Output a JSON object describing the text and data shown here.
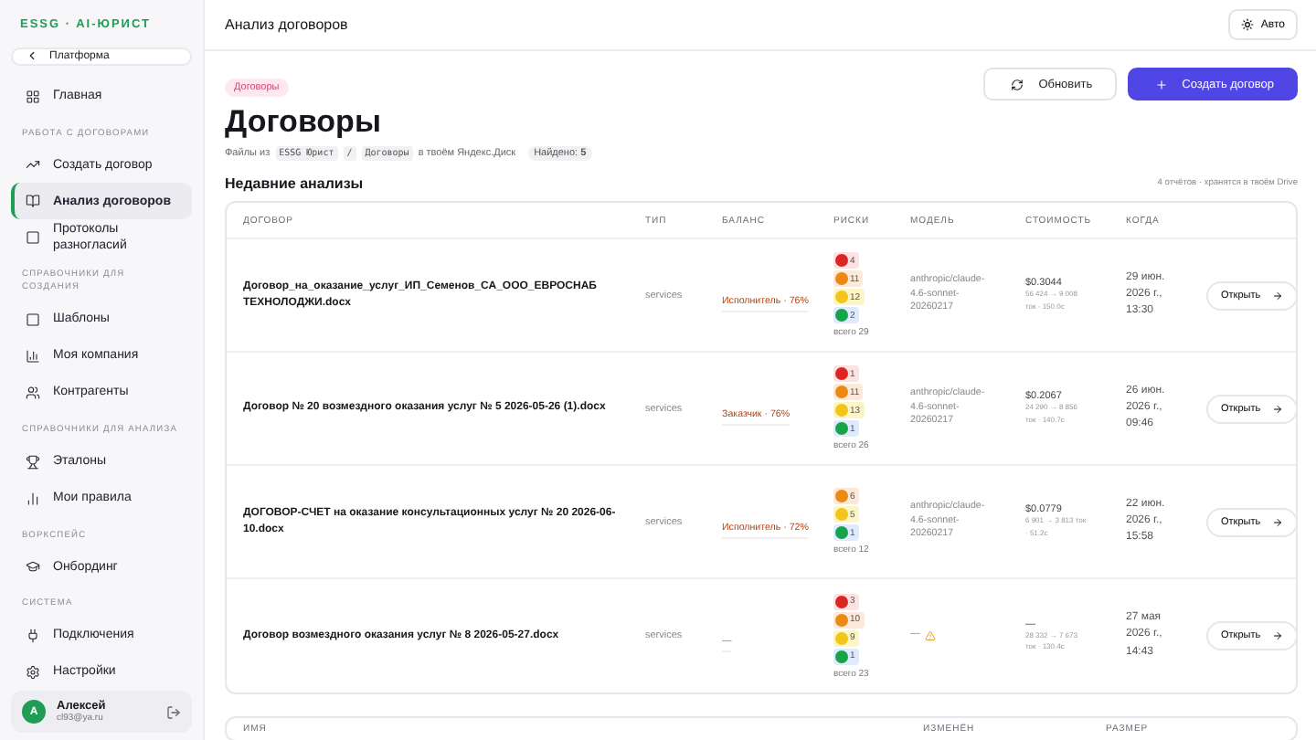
{
  "sidebar": {
    "logo": "ESSG · AI-ЮРИСТ",
    "back_button": "Платформа",
    "sections": [
      {
        "items": [
          {
            "label": "Главная",
            "selected": false
          }
        ]
      },
      {
        "title": "РАБОТА С ДОГОВОРАМИ",
        "items": [
          {
            "label": "Создать договор",
            "selected": false
          },
          {
            "label": "Анализ договоров",
            "selected": true
          },
          {
            "label": "Протоколы разногласий",
            "selected": false
          }
        ]
      },
      {
        "title": "СПРАВОЧНИКИ ДЛЯ СОЗДАНИЯ",
        "items": [
          {
            "label": "Шаблоны",
            "selected": false
          },
          {
            "label": "Моя компания",
            "selected": false
          },
          {
            "label": "Контрагенты",
            "selected": false
          }
        ]
      },
      {
        "title": "СПРАВОЧНИКИ ДЛЯ АНАЛИЗА",
        "items": [
          {
            "label": "Эталоны",
            "selected": false
          },
          {
            "label": "Мои правила",
            "selected": false
          }
        ]
      },
      {
        "title": "ВОРКСПЕЙС",
        "items": [
          {
            "label": "Онбординг",
            "selected": false
          }
        ]
      },
      {
        "title": "СИСТЕМА",
        "items": [
          {
            "label": "Подключения",
            "selected": false
          },
          {
            "label": "Настройки",
            "selected": false
          }
        ]
      }
    ],
    "user": {
      "initial": "А",
      "name": "Алексей",
      "email": "cl93@ya.ru"
    }
  },
  "topbar": {
    "title": "Анализ договоров",
    "theme_button": "Авто"
  },
  "page": {
    "badge": "Договоры",
    "title": "Договоры",
    "refresh_button": "Обновить",
    "create_button": "Создать договор",
    "path_prefix": "Файлы из",
    "path_segments": [
      "ESSG Юрист",
      "/",
      "Договоры"
    ],
    "path_suffix": "в твоём Яндекс.Диск",
    "found_label": "Найдено:",
    "found_count": "5"
  },
  "recent": {
    "title": "Недавние анализы",
    "note": "4 отчётов · хранятся в твоём Drive",
    "columns": [
      "ДОГОВОР",
      "ТИП",
      "БАЛАНС",
      "РИСКИ",
      "МОДЕЛЬ",
      "СТОИМОСТЬ",
      "КОГДА"
    ],
    "rows": [
      {
        "name": "Договор_на_оказание_услуг_ИП_Семенов_СА_ООО_ЕВРОСНАБ ТЕХНОЛОДЖИ.docx",
        "type": "services",
        "balance": "Исполнитель · 76%",
        "risks": [
          {
            "color": "#dc2626",
            "count": "4"
          },
          {
            "color": "#ea8a12",
            "count": "11"
          },
          {
            "color": "#f2c51b",
            "count": "12"
          },
          {
            "color": "#16a34a",
            "count": "2"
          }
        ],
        "risk_total": "всего 29",
        "model": "anthropic/claude-4.6-sonnet-20260217",
        "model_warning": false,
        "cost": "$0.3044",
        "tokens": "56 424 → 9 008",
        "tokens_detail": "ток · 150.0с",
        "when": "29 июн. 2026 г., 13:30",
        "open_button": "Открыть"
      },
      {
        "name": "Договор № 20 возмездного оказания услуг № 5 2026-05-26 (1).docx",
        "type": "services",
        "balance": "Заказчик · 76%",
        "risks": [
          {
            "color": "#dc2626",
            "count": "1"
          },
          {
            "color": "#ea8a12",
            "count": "11"
          },
          {
            "color": "#f2c51b",
            "count": "13"
          },
          {
            "color": "#16a34a",
            "count": "1"
          }
        ],
        "risk_total": "всего 26",
        "model": "anthropic/claude-4.6-sonnet-20260217",
        "model_warning": false,
        "cost": "$0.2067",
        "tokens": "24 290 → 8 856",
        "tokens_detail": "ток · 140.7с",
        "when": "26 июн. 2026 г., 09:46",
        "open_button": "Открыть"
      },
      {
        "name": "ДОГОВОР-СЧЕТ на оказание консультационных услуг № 20 2026-06-10.docx",
        "type": "services",
        "balance": "Исполнитель · 72%",
        "risks": [
          {
            "color": "#ea8a12",
            "count": "6"
          },
          {
            "color": "#f2c51b",
            "count": "5"
          },
          {
            "color": "#16a34a",
            "count": "1"
          }
        ],
        "risk_total": "всего 12",
        "model": "anthropic/claude-4.6-sonnet-20260217",
        "model_warning": false,
        "cost": "$0.0779",
        "tokens": "6 901 → 3 813 ток",
        "tokens_detail": "· 51.2с",
        "when": "22 июн. 2026 г., 15:58",
        "open_button": "Открыть"
      },
      {
        "name": "Договор возмездного оказания услуг № 8 2026-05-27.docx",
        "type": "services",
        "balance": "—",
        "risks": [
          {
            "color": "#dc2626",
            "count": "3"
          },
          {
            "color": "#ea8a12",
            "count": "10"
          },
          {
            "color": "#f2c51b",
            "count": "9"
          },
          {
            "color": "#16a34a",
            "count": "1"
          }
        ],
        "risk_total": "всего 23",
        "model": "—",
        "model_warning": true,
        "cost": "—",
        "tokens": "28 332 → 7 673",
        "tokens_detail": "ток · 130.4с",
        "when": "27 мая 2026 г., 14:43",
        "open_button": "Открыть"
      }
    ]
  },
  "files": {
    "columns": [
      "ИМЯ",
      "ИЗМЕНЁН",
      "РАЗМЕР"
    ]
  }
}
